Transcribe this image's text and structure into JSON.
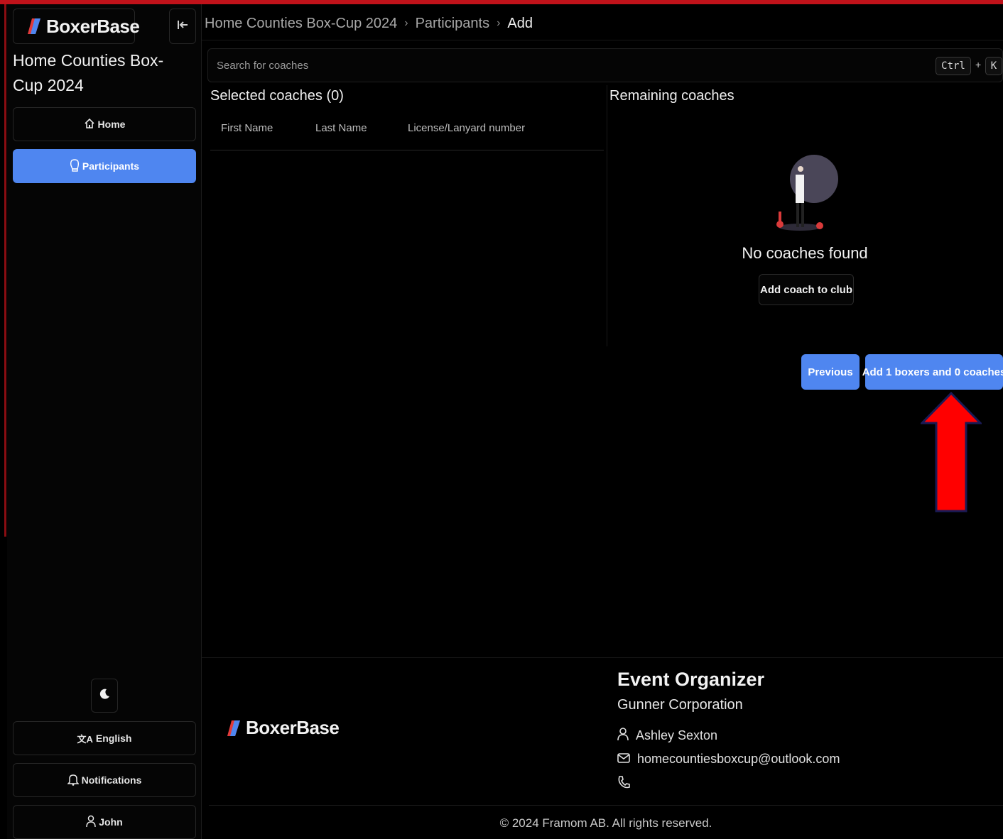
{
  "app": {
    "name": "BoxerBase",
    "brand_color": "#4f86f0"
  },
  "sidebar": {
    "event_title": "Home Counties Box-Cup 2024",
    "nav": [
      {
        "label": "Home",
        "icon": "home-icon"
      },
      {
        "label": "Participants",
        "icon": "glove-icon",
        "active": true
      }
    ],
    "bottom": {
      "language": "English",
      "notifications": "Notifications",
      "user": "John"
    }
  },
  "breadcrumb": [
    "Home Counties Box-Cup 2024",
    "Participants",
    "Add"
  ],
  "search": {
    "placeholder": "Search for coaches",
    "shortcut": [
      "Ctrl",
      "+",
      "K"
    ]
  },
  "selected": {
    "title": "Selected coaches (0)",
    "columns": [
      "First Name",
      "Last Name",
      "License/Lanyard number"
    ],
    "rows": []
  },
  "remaining": {
    "title": "Remaining coaches",
    "empty_message": "No coaches found",
    "add_button": "Add coach to club"
  },
  "actions": {
    "previous": "Previous",
    "submit": "Add 1 boxers and 0 coaches"
  },
  "footer": {
    "organizer_heading": "Event Organizer",
    "organizer_name": "Gunner Corporation",
    "contact_person": "Ashley Sexton",
    "email": "homecountiesboxcup@outlook.com",
    "copyright": "© 2024 Framom AB. All rights reserved."
  },
  "annotation": {
    "arrow_color": "#ff0000"
  }
}
